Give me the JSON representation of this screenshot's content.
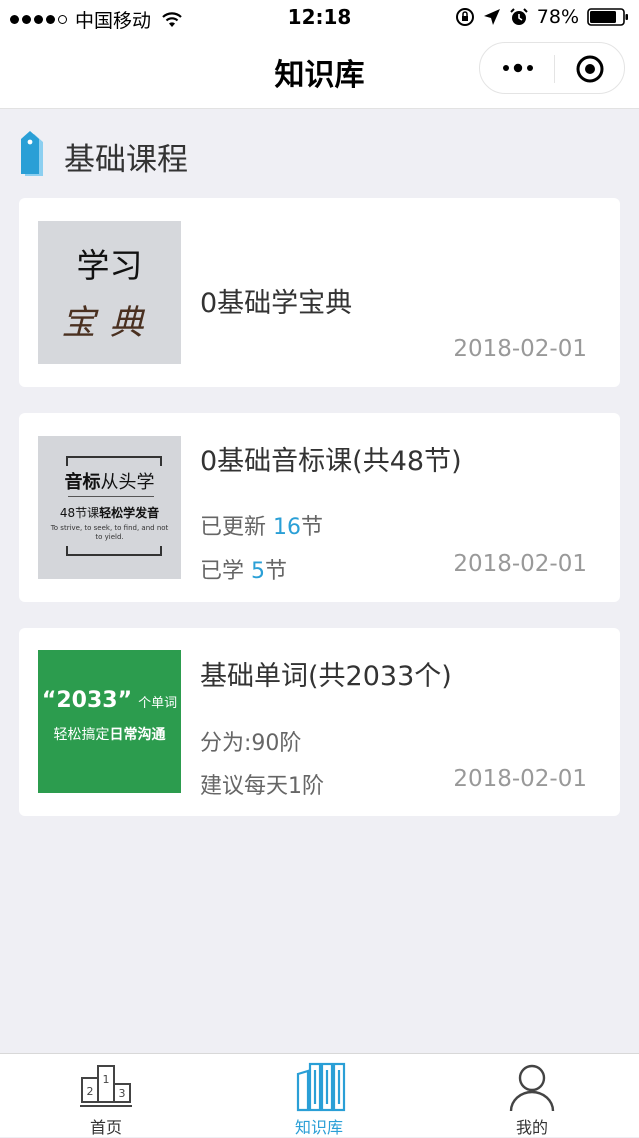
{
  "status_bar": {
    "carrier": "中国移动",
    "time": "12:18",
    "battery": "78%"
  },
  "nav": {
    "title": "知识库",
    "more_icon": "more-dots-icon",
    "close_icon": "target-circle-icon"
  },
  "section": {
    "title": "基础课程",
    "icon": "tag-icon"
  },
  "courses": [
    {
      "title": "0基础学宝典",
      "date": "2018-02-01",
      "thumb": {
        "line1": "学习",
        "line2": "宝典"
      }
    },
    {
      "title": "0基础音标课(共48节)",
      "updated_prefix": "已更新 ",
      "updated_count": "16",
      "updated_suffix": "节",
      "learned_prefix": "已学 ",
      "learned_count": "5",
      "learned_suffix": "节",
      "date": "2018-02-01",
      "thumb": {
        "h1_bold": "音标",
        "h1_rest": "从头学",
        "h2_pre": "48节课",
        "h2_bold": "轻松学发音",
        "h3": "To strive, to seek, to find, and not to yield."
      }
    },
    {
      "title": "基础单词(共2033个)",
      "meta1": "分为:90阶",
      "meta2": "建议每天1阶",
      "date": "2018-02-01",
      "thumb": {
        "big": "“2033”",
        "small": "个单词",
        "l2_pre": "轻松搞定",
        "l2_bold": "日常沟通"
      }
    }
  ],
  "tab_bar": {
    "tabs": [
      {
        "label": "首页",
        "icon": "podium-icon",
        "active": false
      },
      {
        "label": "知识库",
        "icon": "books-icon",
        "active": true
      },
      {
        "label": "我的",
        "icon": "user-icon",
        "active": false
      }
    ]
  },
  "colors": {
    "accent": "#2a9fd6",
    "background": "#efeff4",
    "green_thumb": "#2c9c4e"
  }
}
